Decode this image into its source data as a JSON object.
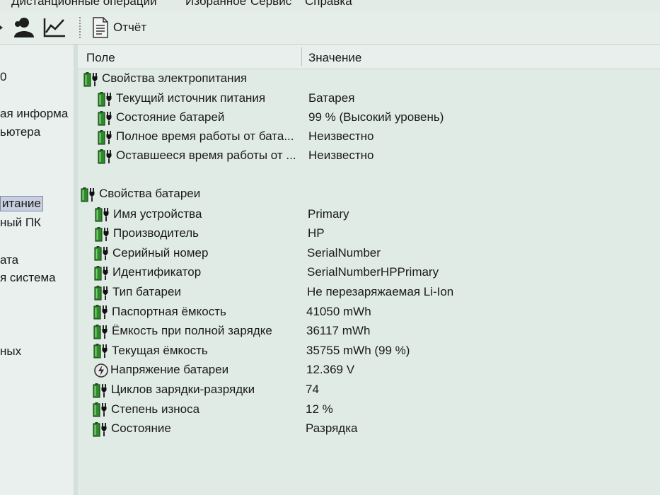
{
  "menu": {
    "items": [
      "Дистанционные операции",
      "Избранное",
      "Сервис",
      "Справка"
    ]
  },
  "toolbar": {
    "report_label": "Отчёт"
  },
  "left_tree": {
    "items": [
      "0",
      "ая информа",
      "ьютера",
      "итание",
      "ный ПК",
      "ата",
      "я система",
      "ных"
    ],
    "selected_index": 3
  },
  "columns": {
    "field": "Поле",
    "value": "Значение"
  },
  "power_group": {
    "title": "Свойства электропитания",
    "rows": [
      {
        "field": "Текущий источник питания",
        "value": "Батарея",
        "icon": "battery-plug-icon"
      },
      {
        "field": "Состояние батарей",
        "value": "99 % (Высокий уровень)",
        "icon": "battery-plug-icon"
      },
      {
        "field": "Полное время работы от бата...",
        "value": "Неизвестно",
        "icon": "battery-plug-icon"
      },
      {
        "field": "Оставшееся время работы от ...",
        "value": "Неизвестно",
        "icon": "battery-plug-icon"
      }
    ]
  },
  "battery_group": {
    "title": "Свойства батареи",
    "rows": [
      {
        "field": "Имя устройства",
        "value": "Primary",
        "icon": "battery-plug-icon"
      },
      {
        "field": "Производитель",
        "value": "HP",
        "icon": "battery-plug-icon"
      },
      {
        "field": "Серийный номер",
        "value": "SerialNumber",
        "icon": "battery-plug-icon"
      },
      {
        "field": "Идентификатор",
        "value": "SerialNumberHPPrimary",
        "icon": "battery-plug-icon"
      },
      {
        "field": "Тип батареи",
        "value": "Не перезаряжаемая Li-Ion",
        "icon": "battery-plug-icon"
      },
      {
        "field": "Паспортная ёмкость",
        "value": "41050 mWh",
        "icon": "battery-plug-icon"
      },
      {
        "field": "Ёмкость при полной зарядке",
        "value": "36117 mWh",
        "icon": "battery-plug-icon"
      },
      {
        "field": "Текущая ёмкость",
        "value": "35755 mWh  (99 %)",
        "icon": "battery-plug-icon"
      },
      {
        "field": "Напряжение батареи",
        "value": "12.369 V",
        "icon": "voltage-icon"
      },
      {
        "field": "Циклов зарядки-разрядки",
        "value": "74",
        "icon": "battery-plug-icon"
      },
      {
        "field": "Степень износа",
        "value": "12 %",
        "icon": "battery-plug-icon"
      },
      {
        "field": "Состояние",
        "value": "Разрядка",
        "icon": "battery-plug-icon"
      }
    ]
  },
  "colors": {
    "battery_green": "#2f8a2a",
    "battery_dark": "#1d4a1a",
    "selection": "#c8d0e0"
  }
}
